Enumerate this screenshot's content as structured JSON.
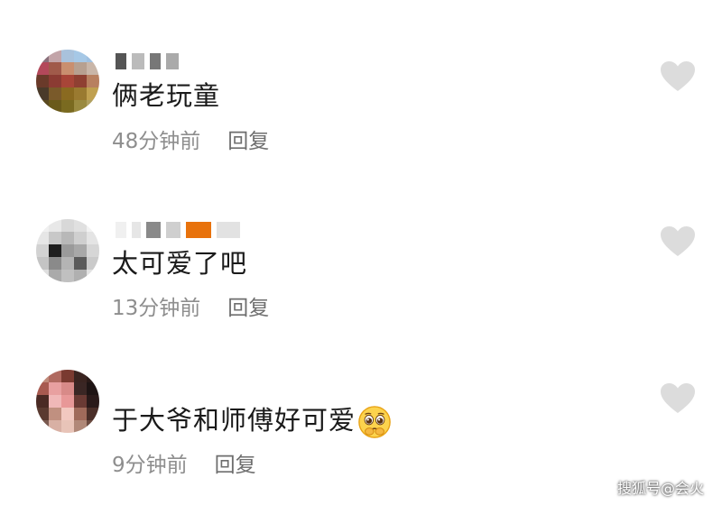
{
  "comments": [
    {
      "text": "俩老玩童",
      "time": "48分钟前",
      "reply": "回复"
    },
    {
      "text": "太可爱了吧",
      "time": "13分钟前",
      "reply": "回复"
    },
    {
      "text": "于大爷和师傅好可爱",
      "time": "9分钟前",
      "reply": "回复",
      "emoji": "pleading-face-emoji"
    }
  ],
  "icons": {
    "like": "heart-icon"
  },
  "colors": {
    "text": "#1a1a1a",
    "meta": "#8e8e8e",
    "heart": "#dcdcdc",
    "background": "#ffffff"
  },
  "watermark": "搜狐号@会火"
}
